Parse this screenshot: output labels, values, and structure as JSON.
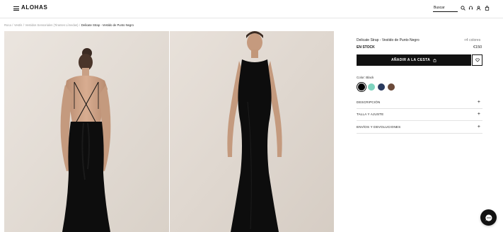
{
  "header": {
    "logo": "ALOHAS",
    "search_placeholder": "Buscar",
    "icons": [
      "menu-icon",
      "search-icon",
      "support-icon",
      "account-icon",
      "bag-icon"
    ]
  },
  "breadcrumb": [
    {
      "label": "Roca"
    },
    {
      "label": "Vestís"
    },
    {
      "label": "Vestidos Sensoriales (Tirantes Límedas)"
    },
    {
      "label": "Delicate Strap - Vestido de Punto Negro",
      "current": true
    }
  ],
  "product": {
    "title": "Delicate Strap - Vestido de Punto Negro",
    "colors_count": "+4 colores",
    "stock": "EN STOCK",
    "price": "€150",
    "add_to_cart": "AÑADIR A LA CESTA",
    "color_label": "Color: Black",
    "swatches": [
      {
        "name": "Black",
        "color": "#000000",
        "selected": true
      },
      {
        "name": "Mint",
        "color": "#7ed3bf",
        "selected": false
      },
      {
        "name": "Navy",
        "color": "#2a3a5e",
        "selected": false
      },
      {
        "name": "Brown",
        "color": "#6b4a3a",
        "selected": false
      }
    ],
    "accordion": [
      {
        "label": "DESCRIPCIÓN"
      },
      {
        "label": "TALLA Y AJUSTE"
      },
      {
        "label": "ENVÍOS Y DEVOLUCIONES"
      }
    ]
  },
  "colors": {
    "background": "#ffffff",
    "photo_backdrop": "#e3dcd5",
    "dress": "#0d0d0d",
    "button": "#111111"
  }
}
